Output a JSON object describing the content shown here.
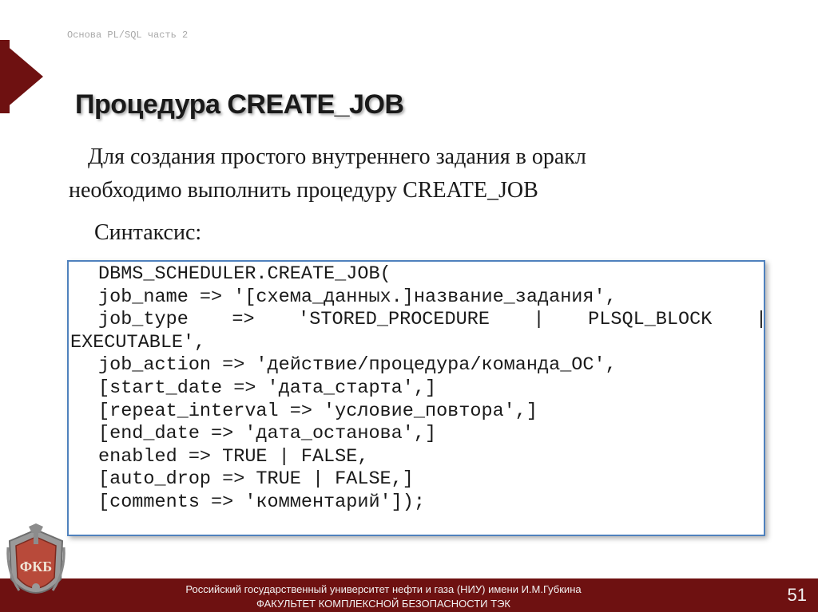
{
  "header": {
    "caption": "Основа PL/SQL часть 2"
  },
  "slide": {
    "title": "Процедура CREATE_JOB",
    "intro_line1": "Для создания простого внутреннего задания в оракл",
    "intro_line2": "необходимо выполнить процедуру CREATE_JOB",
    "syntax_label": "Синтаксис:"
  },
  "code": {
    "lines": [
      "DBMS_SCHEDULER.CREATE_JOB(",
      "job_name => '[схема_данных.]название_задания',",
      "job_type => 'STORED_PROCEDURE | PLSQL_BLOCK |",
      "EXECUTABLE',",
      "job_action => 'действие/процедура/команда_ОС',",
      "[start_date => 'дата_старта',]",
      "[repeat_interval => 'условие_повтора',]",
      "[end_date => 'дата_останова',]",
      "enabled => TRUE | FALSE,",
      "[auto_drop => TRUE | FALSE,]",
      "[comments => 'комментарий']);"
    ]
  },
  "footer": {
    "line1": "Российский государственный университет нефти и газа (НИУ) имени И.М.Губкина",
    "line2": "ФАКУЛЬТЕТ КОМПЛЕКСНОЙ БЕЗОПАСНОСТИ ТЭК",
    "page_number": "51"
  },
  "emblem": {
    "text": "ФКБ"
  },
  "colors": {
    "accent": "#6e1111",
    "code_border": "#4f81bd"
  }
}
